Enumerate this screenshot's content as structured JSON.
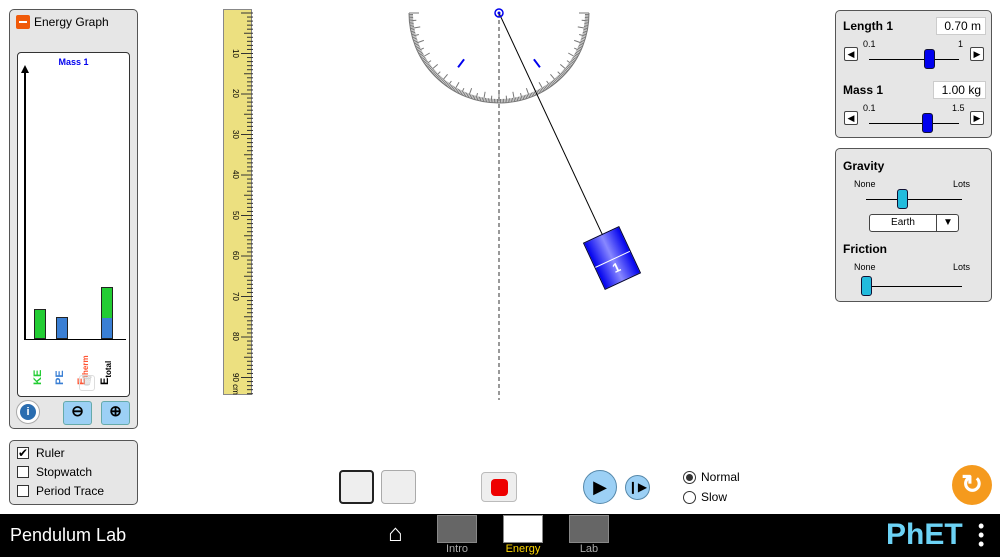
{
  "energy_panel": {
    "title": "Energy Graph",
    "graph_title": "Mass 1",
    "bars": [
      {
        "label": "KE",
        "value": 30,
        "color": "#22cc33"
      },
      {
        "label": "PE",
        "value": 22,
        "color": "#3a7fd4"
      },
      {
        "label": "E",
        "sub": "therm",
        "value": 0,
        "color": "#ff5533"
      },
      {
        "label": "E",
        "sub": "total",
        "value": 52,
        "color": "#000000"
      }
    ]
  },
  "checkboxes": [
    {
      "label": "Ruler",
      "checked": true
    },
    {
      "label": "Stopwatch",
      "checked": false
    },
    {
      "label": "Period Trace",
      "checked": false
    }
  ],
  "ruler": {
    "ticks": [
      "10",
      "20",
      "30",
      "40",
      "50",
      "60",
      "70",
      "80",
      "90 cm"
    ]
  },
  "length": {
    "label": "Length 1",
    "value": "0.70 m",
    "min": "0.1",
    "max": "1",
    "fraction": 0.67
  },
  "mass": {
    "label": "Mass 1",
    "value": "1.00 kg",
    "min": "0.1",
    "max": "1.5",
    "fraction": 0.64
  },
  "gravity": {
    "label": "Gravity",
    "min": "None",
    "max": "Lots",
    "fraction": 0.37,
    "selected": "Earth"
  },
  "friction": {
    "label": "Friction",
    "min": "None",
    "max": "Lots",
    "fraction": 0.0
  },
  "pendulum": {
    "mass_label": "1",
    "angle_deg": 25
  },
  "speed": {
    "options": [
      "Normal",
      "Slow"
    ],
    "selected": "Normal"
  },
  "navbar": {
    "app_title": "Pendulum Lab",
    "tabs": [
      "Intro",
      "Energy",
      "Lab"
    ],
    "active": "Energy",
    "brand": "PhET"
  },
  "colors": {
    "accent": "#0000ee",
    "cyan": "#22bbdd",
    "reset": "#f59a1d",
    "active_tab": "#ffd700"
  }
}
